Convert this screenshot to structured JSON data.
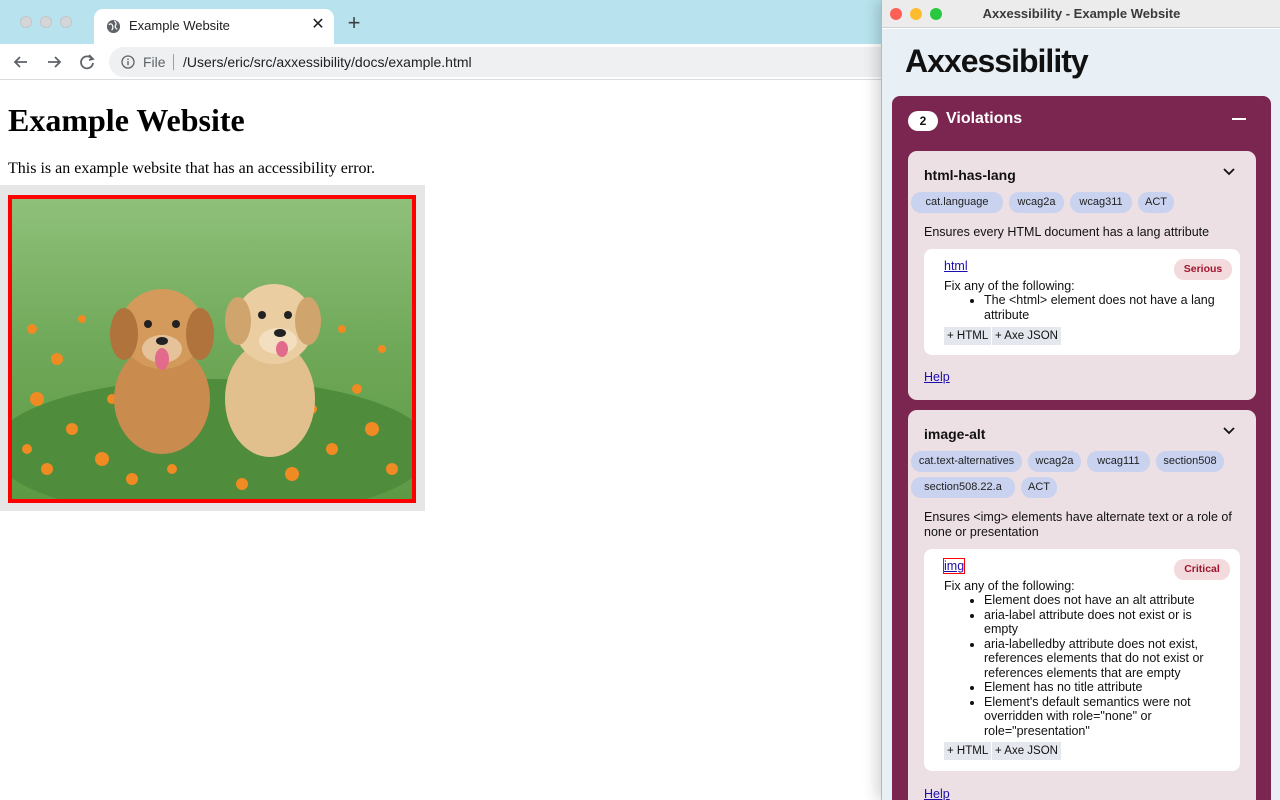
{
  "browser": {
    "tab_title": "Example Website",
    "address_scheme": "File",
    "address_url": "/Users/eric/src/axxessibility/docs/example.html"
  },
  "page": {
    "heading": "Example Website",
    "paragraph": "This is an example website that has an accessibility error."
  },
  "axe": {
    "window_title": "Axxessibility - Example Website",
    "brand": "Axxessibility",
    "violations_label": "Violations",
    "violations_count": "2",
    "violations": [
      {
        "id": "html-has-lang",
        "tags": [
          "cat.language",
          "wcag2a",
          "wcag311",
          "ACT"
        ],
        "description": "Ensures every HTML document has a lang attribute",
        "node": {
          "selector": "html",
          "impact": "Serious",
          "fix_heading": "Fix any of the following:",
          "fixes": [
            "The <html> element does not have a lang attribute"
          ],
          "html_button": "+ HTML",
          "json_button": "+ Axe JSON"
        },
        "help": "Help"
      },
      {
        "id": "image-alt",
        "tags": [
          "cat.text-alternatives",
          "wcag2a",
          "wcag111",
          "section508",
          "section508.22.a",
          "ACT"
        ],
        "description": "Ensures <img> elements have alternate text or a role of none or presentation",
        "node": {
          "selector": "img",
          "impact": "Critical",
          "fix_heading": "Fix any of the following:",
          "fixes": [
            "Element does not have an alt attribute",
            "aria-label attribute does not exist or is empty",
            "aria-labelledby attribute does not exist, references elements that do not exist or references elements that are empty",
            "Element has no title attribute",
            "Element's default semantics were not overridden with role=\"none\" or role=\"presentation\""
          ],
          "html_button": "+ HTML",
          "json_button": "+ Axe JSON"
        },
        "help": "Help"
      }
    ]
  },
  "colors": {
    "tabbar": "#b8e3ee",
    "violations_panel": "#7b2650",
    "card": "#ede0e4",
    "tag": "#c9d2ef",
    "error_border": "#ff0000"
  }
}
